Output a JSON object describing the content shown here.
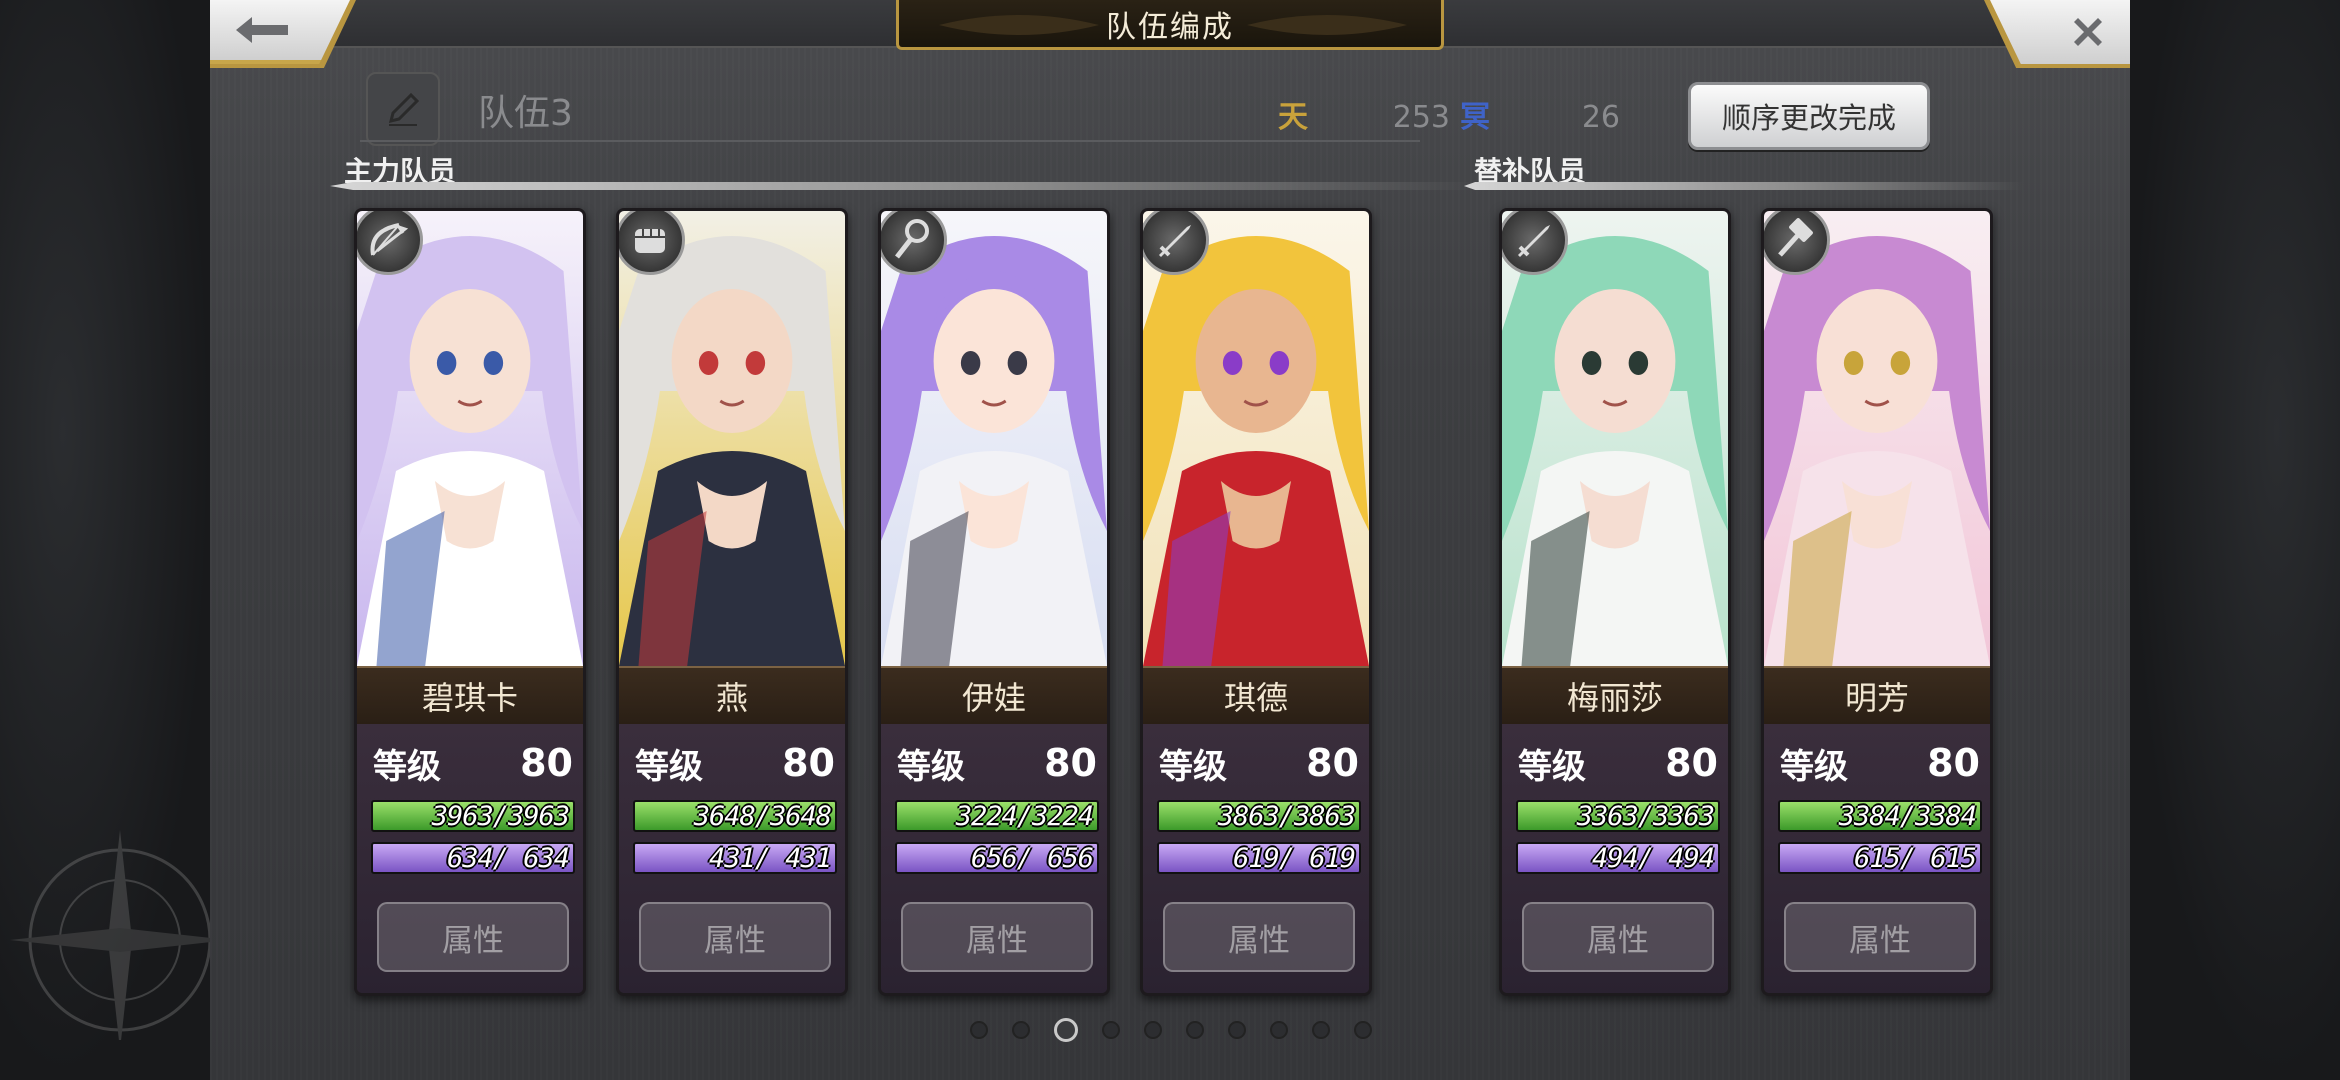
{
  "header": {
    "title": "队伍编成"
  },
  "team": {
    "name": "队伍3",
    "cost1_icon": "天",
    "cost1_value": "253",
    "cost2_icon": "冥",
    "cost2_value": "26",
    "order_button": "顺序更改完成"
  },
  "sections": {
    "main": "主力队员",
    "reserve": "替补队员"
  },
  "members": [
    {
      "name": "碧琪卡",
      "level_label": "等级",
      "level": "80",
      "hp": "3963/3963",
      "mp": " 634/ 634",
      "attr": "属性",
      "class_icon": "bow-icon",
      "colors": {
        "bg1": "#f6f2fa",
        "bg2": "#c8b6ee",
        "hair": "#d2c2f0",
        "skin": "#f7e1d4",
        "cloth": "#ffffff",
        "accent": "#3a5aa8"
      }
    },
    {
      "name": "燕",
      "level_label": "等级",
      "level": "80",
      "hp": "3648/3648",
      "mp": " 431/ 431",
      "attr": "属性",
      "class_icon": "fist-icon",
      "colors": {
        "bg1": "#f2f0e6",
        "bg2": "#e6c74a",
        "hair": "#e2e0dc",
        "skin": "#f3d8c6",
        "cloth": "#2c3040",
        "accent": "#c23a3a"
      }
    },
    {
      "name": "伊娃",
      "level_label": "等级",
      "level": "80",
      "hp": "3224/3224",
      "mp": " 656/ 656",
      "attr": "属性",
      "class_icon": "staff-icon",
      "colors": {
        "bg1": "#f6f6fa",
        "bg2": "#d8def2",
        "hair": "#a98ae6",
        "skin": "#fbe4d8",
        "cloth": "#f2f2f6",
        "accent": "#3a3a48"
      }
    },
    {
      "name": "琪德",
      "level_label": "等级",
      "level": "80",
      "hp": "3863/3863",
      "mp": " 619/ 619",
      "attr": "属性",
      "class_icon": "sword-icon",
      "colors": {
        "bg1": "#fbf6ea",
        "bg2": "#f2e2b8",
        "hair": "#f2c43c",
        "skin": "#e8b690",
        "cloth": "#c8242c",
        "accent": "#8a3cc8"
      }
    },
    {
      "name": "梅丽莎",
      "level_label": "等级",
      "level": "80",
      "hp": "3363/3363",
      "mp": " 494/ 494",
      "attr": "属性",
      "class_icon": "sword-icon",
      "colors": {
        "bg1": "#eef4f0",
        "bg2": "#b8e2cc",
        "hair": "#8ed8b8",
        "skin": "#f5ddd2",
        "cloth": "#f4f6f4",
        "accent": "#2a3a34"
      }
    },
    {
      "name": "明芳",
      "level_label": "等级",
      "level": "80",
      "hp": "3384/3384",
      "mp": " 615/ 615",
      "attr": "属性",
      "class_icon": "hammer-icon",
      "colors": {
        "bg1": "#f8eef2",
        "bg2": "#f2c6d8",
        "hair": "#c88ad2",
        "skin": "#f8e0d6",
        "cloth": "#f6e2ea",
        "accent": "#c8a43a"
      }
    }
  ],
  "pager": {
    "count": 10,
    "active_index": 2
  }
}
